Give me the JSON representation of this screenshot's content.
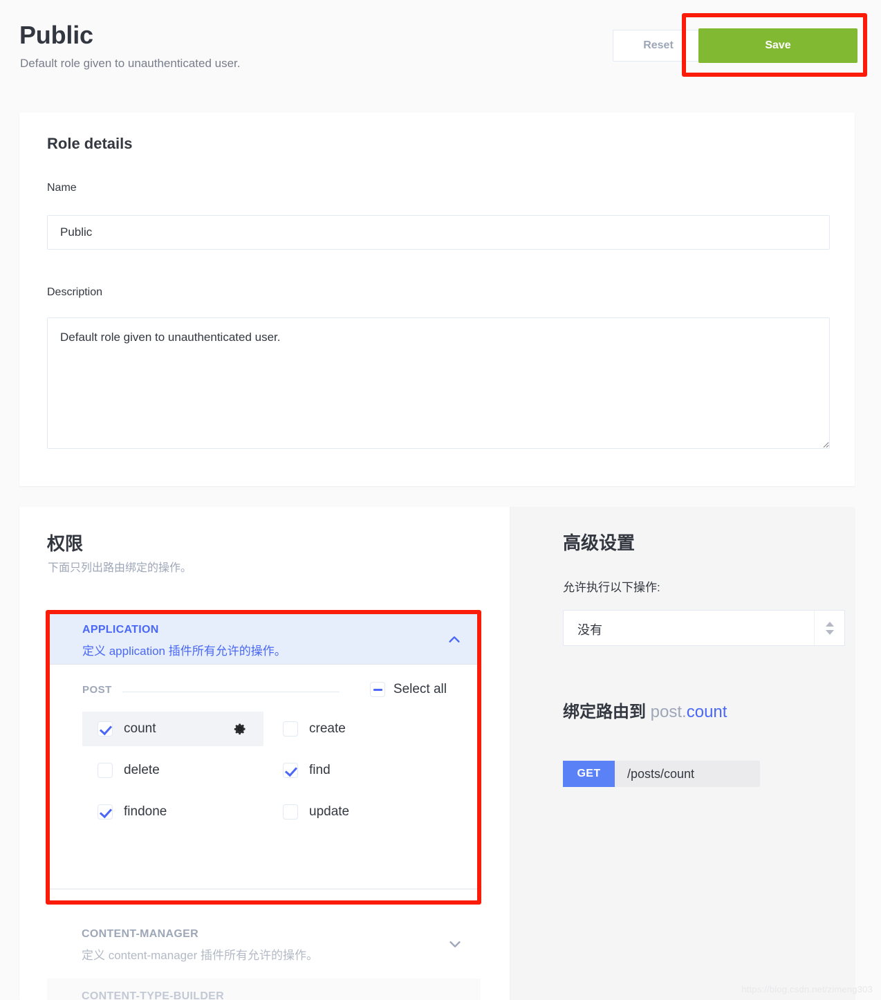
{
  "header": {
    "title": "Public",
    "subtitle": "Default role given to unauthenticated user.",
    "reset_label": "Reset",
    "save_label": "Save",
    "save_color": "#82b933",
    "annotation_color": "#fa1b08"
  },
  "role_details": {
    "heading": "Role details",
    "name_label": "Name",
    "name_value": "Public",
    "name_placeholder": "Name",
    "description_label": "Description",
    "description_value": "Default role given to unauthenticated user.",
    "description_placeholder": "Description"
  },
  "permissions": {
    "heading": "权限",
    "subheading": "下面只列出路由绑定的操作。",
    "accordions": [
      {
        "name": "APPLICATION",
        "description": "定义 application 插件所有允许的操作。",
        "expanded": true,
        "chevron": "chevron-up-icon",
        "group_label": "POST",
        "select_all_label": "Select all",
        "select_all_state": "indeterminate",
        "items": [
          {
            "label": "count",
            "checked": true,
            "active": true,
            "gear": true
          },
          {
            "label": "create",
            "checked": false,
            "active": false,
            "gear": false
          },
          {
            "label": "delete",
            "checked": false,
            "active": false,
            "gear": false
          },
          {
            "label": "find",
            "checked": true,
            "active": false,
            "gear": false
          },
          {
            "label": "findone",
            "checked": true,
            "active": false,
            "gear": false
          },
          {
            "label": "update",
            "checked": false,
            "active": false,
            "gear": false
          }
        ]
      },
      {
        "name": "CONTENT-MANAGER",
        "description": "定义 content-manager 插件所有允许的操作。",
        "expanded": false,
        "chevron": "chevron-down-icon"
      },
      {
        "name": "CONTENT-TYPE-BUILDER",
        "description": "",
        "expanded": false,
        "chevron": "chevron-down-icon"
      }
    ]
  },
  "advanced": {
    "heading": "高级设置",
    "select_label": "允许执行以下操作:",
    "select_value": "没有",
    "bind_title_prefix": "绑定路由到",
    "bind_object": "post",
    "bind_separator": ".",
    "bind_action": "count",
    "route_method": "GET",
    "route_method_color": "#5b81f7",
    "route_path": "/posts/count"
  },
  "watermark": "https://blog.csdn.net/zimeng303"
}
